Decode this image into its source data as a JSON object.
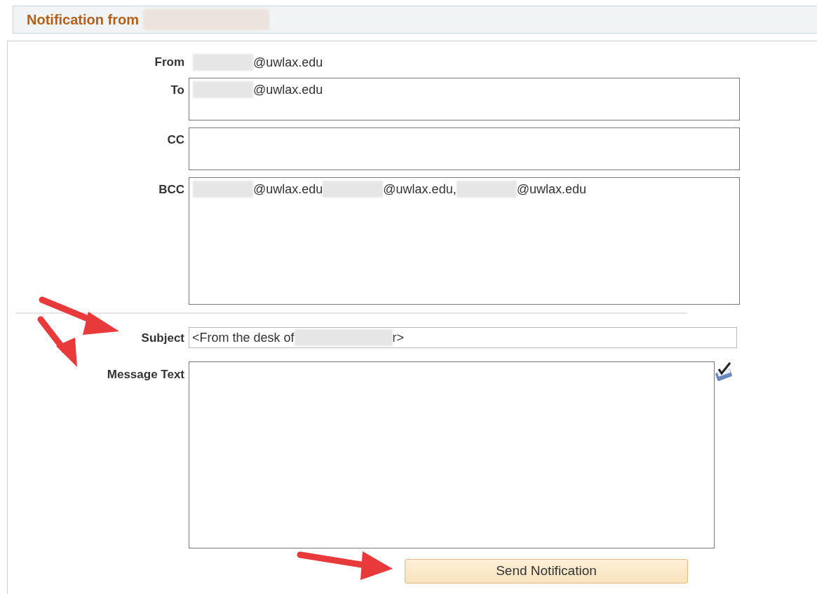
{
  "header": {
    "title": "Notification from"
  },
  "from": {
    "label": "From",
    "addresses": [
      "@uwlax.edu"
    ]
  },
  "to": {
    "label": "To",
    "addresses": [
      "@uwlax.edu"
    ]
  },
  "cc": {
    "label": "CC"
  },
  "bcc": {
    "label": "BCC",
    "addresses": [
      "@uwlax.edu",
      "@uwlax.edu,",
      "@uwlax.edu"
    ]
  },
  "subject": {
    "label": "Subject",
    "parts": [
      "<From the desk of",
      "r>"
    ]
  },
  "message": {
    "label": "Message Text"
  },
  "button": {
    "label": "Send Notification"
  }
}
